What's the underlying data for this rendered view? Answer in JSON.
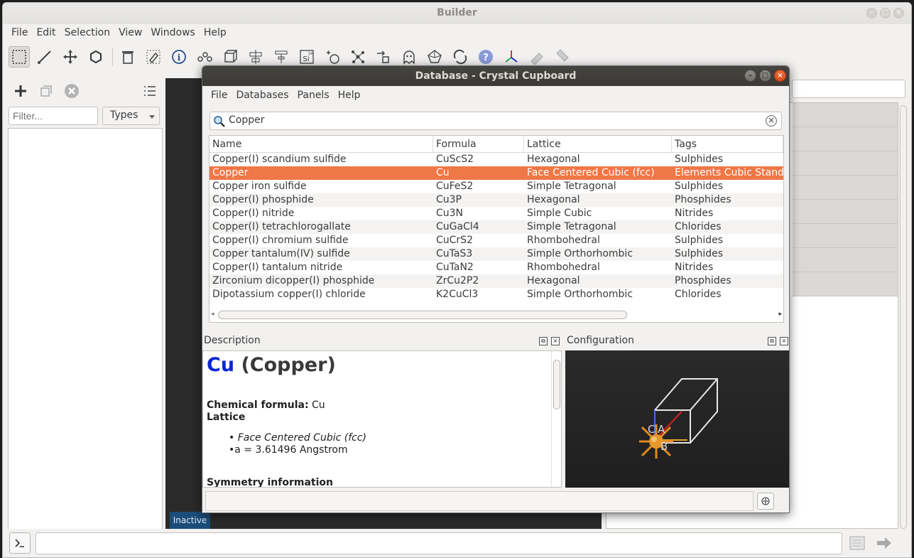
{
  "app": {
    "title": "Builder"
  },
  "menu": [
    "File",
    "Edit",
    "Selection",
    "View",
    "Windows",
    "Help"
  ],
  "toolbar": {
    "tools": [
      "select-rect-icon",
      "measure-ruler-icon",
      "move-icon",
      "hexagon-icon",
      "trash-icon",
      "tag-icon",
      "info-icon",
      "molecule-icon",
      "cube-icon",
      "align-icon",
      "tree-icon",
      "element-si-icon",
      "atom-h-icon",
      "network-icon",
      "arrow-group-icon",
      "ghost-icon",
      "polyhedron-icon",
      "rotate-icon",
      "help-sphere-icon",
      "axes-icon",
      "pin-icon",
      "pin2-icon"
    ],
    "element_label": "Si",
    "element_number": "14"
  },
  "left_panel": {
    "filter_placeholder": "Filter...",
    "types_label": "Types"
  },
  "viewport": {
    "status": "Inactive"
  },
  "dialog": {
    "title": "Database - Crystal Cupboard",
    "menu": [
      "File",
      "Databases",
      "Panels",
      "Help"
    ],
    "search": {
      "value": "Copper"
    },
    "columns": [
      "Name",
      "Formula",
      "Lattice",
      "Tags"
    ],
    "rows": [
      {
        "name": "Copper(I) scandium sulfide",
        "formula": "CuScS2",
        "lattice": "Hexagonal",
        "tags": "Sulphides"
      },
      {
        "name": "Copper",
        "formula": "Cu",
        "lattice": "Face Centered Cubic (fcc)",
        "tags": "Elements Cubic Standa"
      },
      {
        "name": "Copper iron sulfide",
        "formula": "CuFeS2",
        "lattice": "Simple Tetragonal",
        "tags": "Sulphides"
      },
      {
        "name": "Copper(I) phosphide",
        "formula": "Cu3P",
        "lattice": "Hexagonal",
        "tags": "Phosphides"
      },
      {
        "name": "Copper(I) nitride",
        "formula": "Cu3N",
        "lattice": "Simple Cubic",
        "tags": "Nitrides"
      },
      {
        "name": "Copper(I) tetrachlorogallate",
        "formula": "CuGaCl4",
        "lattice": "Simple Tetragonal",
        "tags": "Chlorides"
      },
      {
        "name": "Copper(I) chromium sulfide",
        "formula": "CuCrS2",
        "lattice": "Rhombohedral",
        "tags": "Sulphides"
      },
      {
        "name": "Copper tantalum(IV) sulfide",
        "formula": "CuTaS3",
        "lattice": "Simple Orthorhombic",
        "tags": "Sulphides"
      },
      {
        "name": "Copper(I) tantalum nitride",
        "formula": "CuTaN2",
        "lattice": "Rhombohedral",
        "tags": "Nitrides"
      },
      {
        "name": "Zirconium dicopper(I) phosphide",
        "formula": "ZrCu2P2",
        "lattice": "Hexagonal",
        "tags": "Phosphides"
      },
      {
        "name": "Dipotassium copper(I) chloride",
        "formula": "K2CuCl3",
        "lattice": "Simple Orthorhombic",
        "tags": "Chlorides"
      }
    ],
    "selected_row": 1,
    "description": {
      "header": "Description",
      "symbol": "Cu",
      "name": "(Copper)",
      "formula_label": "Chemical formula:",
      "formula_value": "Cu",
      "lattice_label": "Lattice",
      "lattice_type": "Face Centered Cubic (fcc)",
      "lattice_param": "a = 3.61496 Angstrom",
      "symmetry_label": "Symmetry information"
    },
    "configuration": {
      "header": "Configuration",
      "axis_labels": [
        "C",
        "A",
        "B"
      ]
    }
  },
  "colors": {
    "selection": "#f07746",
    "formula_symbol": "#0b25d6",
    "dialog_title_bg": "#3b3a36",
    "close_button": "#e05a26",
    "inactive_badge": "#1b4d7a"
  }
}
